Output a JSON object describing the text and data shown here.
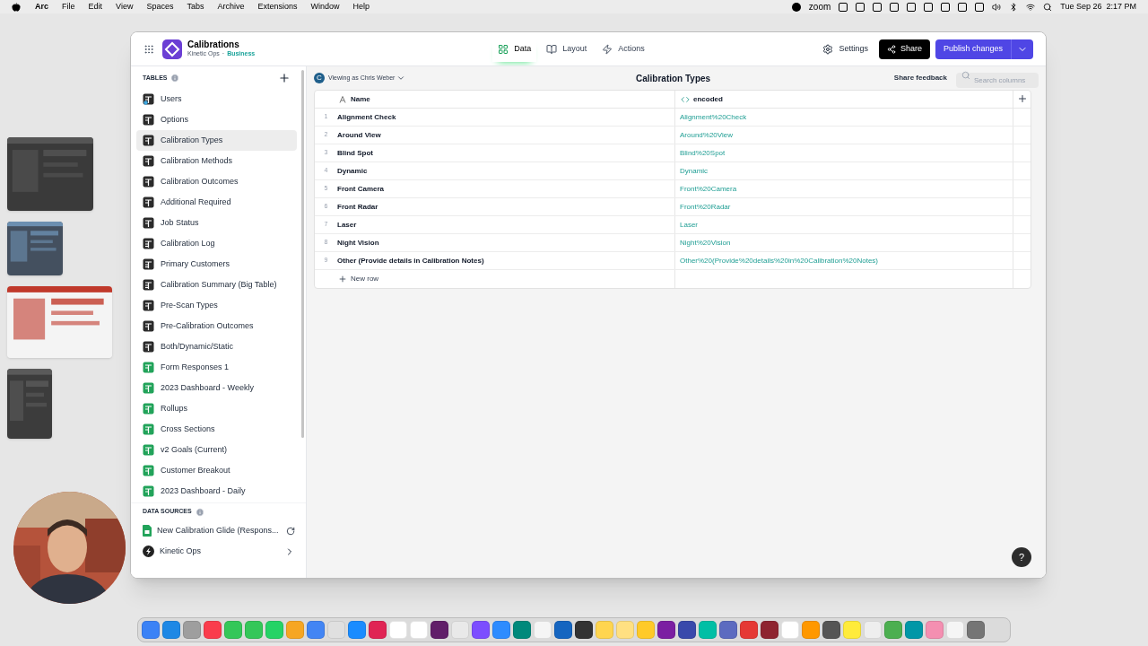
{
  "menu_bar": {
    "app": "Arc",
    "items": [
      "File",
      "Edit",
      "View",
      "Spaces",
      "Tabs",
      "Archive",
      "Extensions",
      "Window",
      "Help"
    ],
    "zoom": "zoom",
    "clock": "Tue Sep 26  2:17 PM"
  },
  "app_header": {
    "title": "Calibrations",
    "org": "Kinetic Ops",
    "separator": "·",
    "plan": "Business",
    "nav": [
      {
        "label": "Data",
        "selected": true,
        "kind": "data"
      },
      {
        "label": "Layout",
        "selected": false,
        "kind": "layout"
      },
      {
        "label": "Actions",
        "selected": false,
        "kind": "actions"
      }
    ],
    "settings": "Settings",
    "share": "Share",
    "publish": "Publish changes"
  },
  "sidebar": {
    "tables_heading": "TABLES",
    "tables": [
      {
        "label": "Users",
        "kind": "users",
        "selected": false
      },
      {
        "label": "Options",
        "kind": "glide",
        "selected": false
      },
      {
        "label": "Calibration Types",
        "kind": "glide",
        "selected": true
      },
      {
        "label": "Calibration Methods",
        "kind": "glide",
        "selected": false
      },
      {
        "label": "Calibration Outcomes",
        "kind": "glide",
        "selected": false
      },
      {
        "label": "Additional Required",
        "kind": "glide",
        "selected": false
      },
      {
        "label": "Job Status",
        "kind": "glide",
        "selected": false
      },
      {
        "label": "Calibration Log",
        "kind": "big",
        "selected": false
      },
      {
        "label": "Primary Customers",
        "kind": "big",
        "selected": false
      },
      {
        "label": "Calibration Summary (Big Table)",
        "kind": "big",
        "selected": false
      },
      {
        "label": "Pre-Scan Types",
        "kind": "glide",
        "selected": false
      },
      {
        "label": "Pre-Calibration Outcomes",
        "kind": "glide",
        "selected": false
      },
      {
        "label": "Both/Dynamic/Static",
        "kind": "glide",
        "selected": false
      },
      {
        "label": "Form Responses 1",
        "kind": "sheet",
        "selected": false
      },
      {
        "label": "2023 Dashboard - Weekly",
        "kind": "sheet",
        "selected": false
      },
      {
        "label": "Rollups",
        "kind": "sheet",
        "selected": false
      },
      {
        "label": "Cross Sections",
        "kind": "sheet",
        "selected": false
      },
      {
        "label": "v2 Goals (Current)",
        "kind": "sheet",
        "selected": false
      },
      {
        "label": "Customer Breakout",
        "kind": "sheet",
        "selected": false
      },
      {
        "label": "2023 Dashboard - Daily",
        "kind": "sheet",
        "selected": false
      }
    ],
    "sources_heading": "DATA SOURCES",
    "sources": [
      {
        "label": "New Calibration Glide (Respons...",
        "kind": "sheet"
      },
      {
        "label": "Kinetic Ops",
        "kind": "glide"
      }
    ]
  },
  "table": {
    "title": "Calibration Types",
    "viewing_as": "Viewing as Chris Weber",
    "avatar": "C",
    "share_feedback": "Share feedback",
    "search": {
      "placeholder": "Search columns"
    },
    "columns": [
      {
        "label": "Name",
        "kind": "text"
      },
      {
        "label": "encoded",
        "kind": "computed"
      }
    ],
    "rows": [
      {
        "index": "1",
        "name": "Alignment Check",
        "encoded": "Alignment%20Check"
      },
      {
        "index": "2",
        "name": "Around View",
        "encoded": "Around%20View"
      },
      {
        "index": "3",
        "name": "Blind Spot",
        "encoded": "Blind%20Spot"
      },
      {
        "index": "4",
        "name": "Dynamic",
        "encoded": "Dynamic"
      },
      {
        "index": "5",
        "name": "Front Camera",
        "encoded": "Front%20Camera"
      },
      {
        "index": "6",
        "name": "Front Radar",
        "encoded": "Front%20Radar"
      },
      {
        "index": "7",
        "name": "Laser",
        "encoded": "Laser"
      },
      {
        "index": "8",
        "name": "Night Vision",
        "encoded": "Night%20Vision"
      },
      {
        "index": "9",
        "name": "Other (Provide details in Calibration Notes)",
        "encoded": "Other%20(Provide%20details%20in%20Calibration%20Notes)"
      }
    ],
    "new_row": "New row"
  },
  "help": "?"
}
